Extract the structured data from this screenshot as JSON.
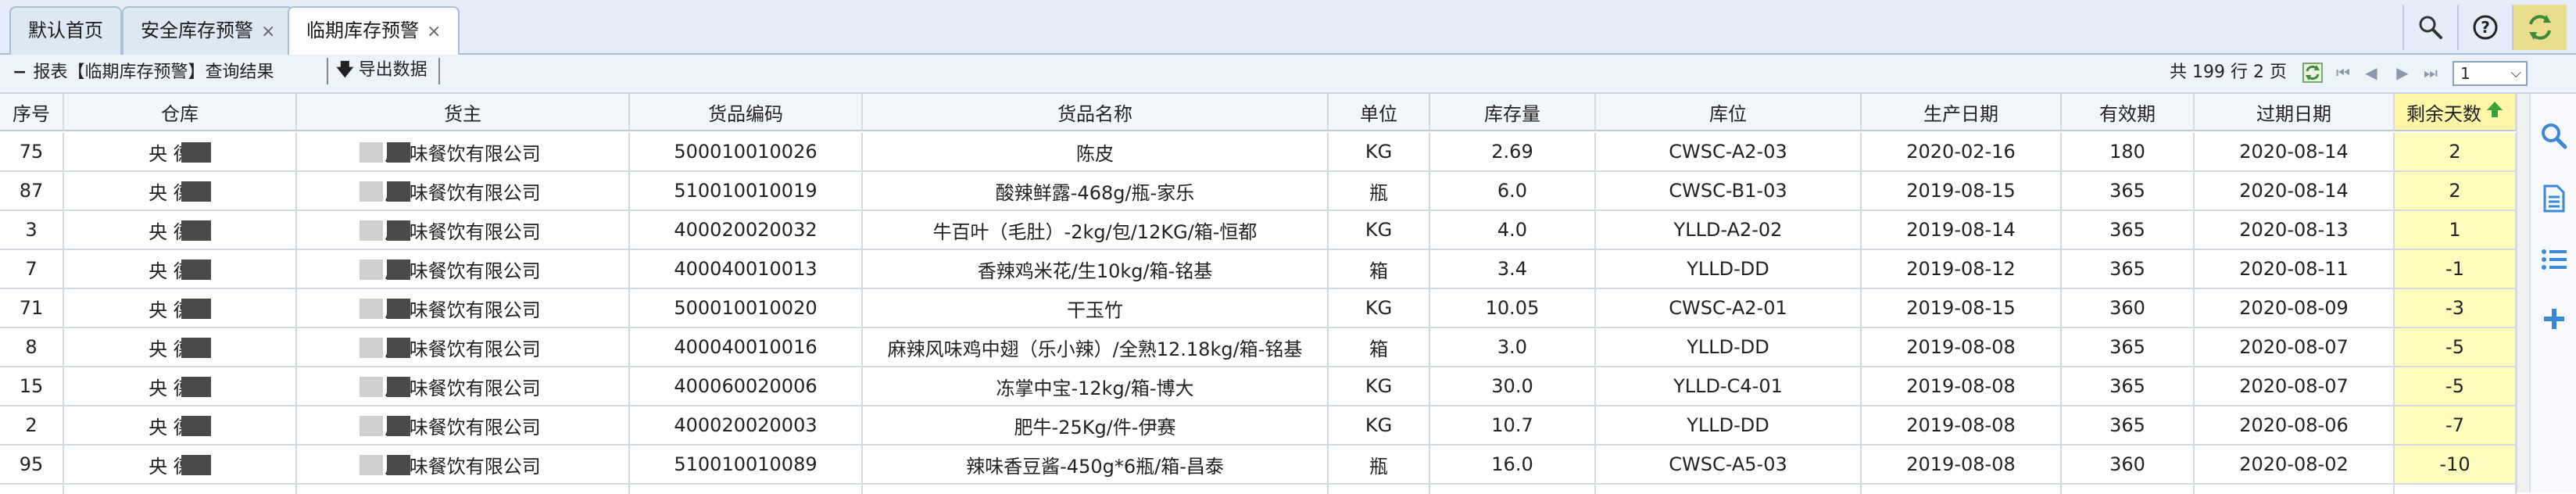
{
  "tabs": [
    {
      "label": "默认首页",
      "closable": false,
      "active": false
    },
    {
      "label": "安全库存预警",
      "closable": true,
      "active": false
    },
    {
      "label": "临期库存预警",
      "closable": true,
      "active": true
    }
  ],
  "topbar_icons": [
    "search-icon",
    "help-icon",
    "refresh-icon"
  ],
  "toolbar": {
    "report_title": "报表【临期库存预警】查询结果",
    "export_label": "导出数据",
    "pager_info": "共 199 行 2 页",
    "page_value": "1"
  },
  "columns": [
    "序号",
    "仓库",
    "货主",
    "货品编码",
    "货品名称",
    "单位",
    "库存量",
    "库位",
    "生产日期",
    "有效期",
    "过期日期",
    "剩余天数"
  ],
  "rows": [
    {
      "seq": "75",
      "warehouse": "央  德库",
      "owner": "广    味餐饮有限公司",
      "code": "500010010026",
      "name": "陈皮",
      "unit": "KG",
      "qty": "2.69",
      "location": "CWSC-A2-03",
      "prod": "2020-02-16",
      "valid": "180",
      "expire": "2020-08-14",
      "remain": "2"
    },
    {
      "seq": "87",
      "warehouse": "央  德库",
      "owner": "广    味餐饮有限公司",
      "code": "510010010019",
      "name": "酸辣鲜露-468g/瓶-家乐",
      "unit": "瓶",
      "qty": "6.0",
      "location": "CWSC-B1-03",
      "prod": "2019-08-15",
      "valid": "365",
      "expire": "2020-08-14",
      "remain": "2"
    },
    {
      "seq": "3",
      "warehouse": "央  德库",
      "owner": "广    味餐饮有限公司",
      "code": "400020020032",
      "name": "牛百叶（毛肚）-2kg/包/12KG/箱-恒都",
      "unit": "KG",
      "qty": "4.0",
      "location": "YLLD-A2-02",
      "prod": "2019-08-14",
      "valid": "365",
      "expire": "2020-08-13",
      "remain": "1"
    },
    {
      "seq": "7",
      "warehouse": "央  德库",
      "owner": "广    味餐饮有限公司",
      "code": "400040010013",
      "name": "香辣鸡米花/生10kg/箱-铭基",
      "unit": "箱",
      "qty": "3.4",
      "location": "YLLD-DD",
      "prod": "2019-08-12",
      "valid": "365",
      "expire": "2020-08-11",
      "remain": "-1"
    },
    {
      "seq": "71",
      "warehouse": "央  德库",
      "owner": "广    味餐饮有限公司",
      "code": "500010010020",
      "name": "干玉竹",
      "unit": "KG",
      "qty": "10.05",
      "location": "CWSC-A2-01",
      "prod": "2019-08-15",
      "valid": "360",
      "expire": "2020-08-09",
      "remain": "-3"
    },
    {
      "seq": "8",
      "warehouse": "央  德库",
      "owner": "广    味餐饮有限公司",
      "code": "400040010016",
      "name": "麻辣风味鸡中翅（乐小辣）/全熟12.18kg/箱-铭基",
      "unit": "箱",
      "qty": "3.0",
      "location": "YLLD-DD",
      "prod": "2019-08-08",
      "valid": "365",
      "expire": "2020-08-07",
      "remain": "-5"
    },
    {
      "seq": "15",
      "warehouse": "央  德库",
      "owner": "广    味餐饮有限公司",
      "code": "400060020006",
      "name": "冻掌中宝-12kg/箱-博大",
      "unit": "KG",
      "qty": "30.0",
      "location": "YLLD-C4-01",
      "prod": "2019-08-08",
      "valid": "365",
      "expire": "2020-08-07",
      "remain": "-5"
    },
    {
      "seq": "2",
      "warehouse": "央  德库",
      "owner": "广    味餐饮有限公司",
      "code": "400020020003",
      "name": "肥牛-25Kg/件-伊赛",
      "unit": "KG",
      "qty": "10.7",
      "location": "YLLD-DD",
      "prod": "2019-08-08",
      "valid": "365",
      "expire": "2020-08-06",
      "remain": "-7"
    },
    {
      "seq": "95",
      "warehouse": "央  德库",
      "owner": "广    味餐饮有限公司",
      "code": "510010010089",
      "name": "辣味香豆酱-450g*6瓶/箱-昌泰",
      "unit": "瓶",
      "qty": "16.0",
      "location": "CWSC-A5-03",
      "prod": "2019-08-08",
      "valid": "360",
      "expire": "2020-08-02",
      "remain": "-10"
    }
  ],
  "side_icons": [
    "search-icon",
    "document-icon",
    "list-icon",
    "add-icon"
  ],
  "colors": {
    "highlight_column": "#fffbbd",
    "sort_arrow": "#3aa03a",
    "side_icon": "#3a88d8"
  }
}
